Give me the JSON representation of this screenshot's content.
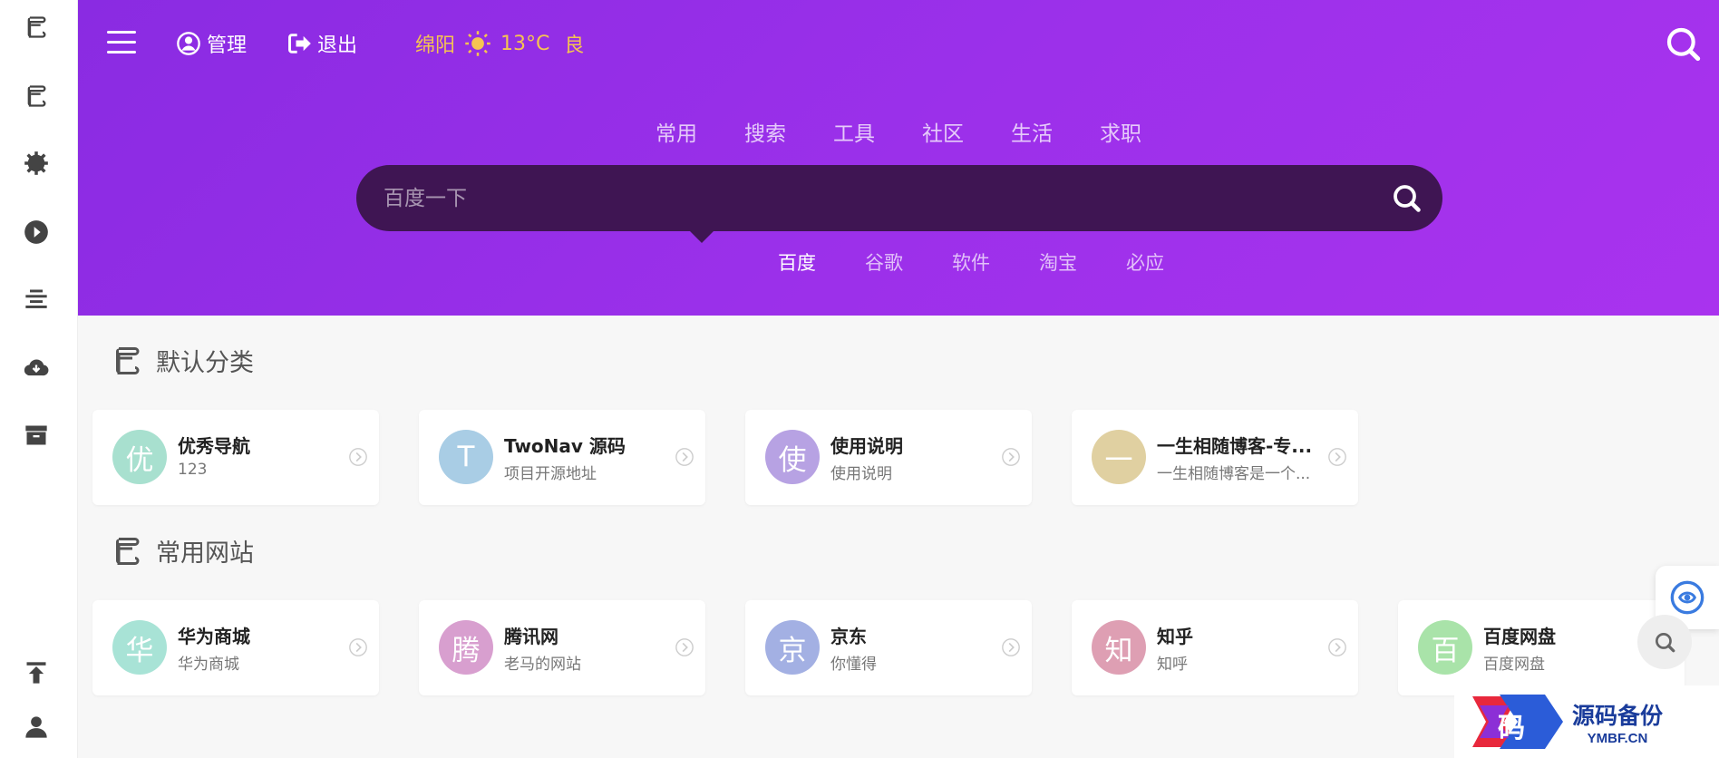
{
  "topbar": {
    "manage_label": "管理",
    "logout_label": "退出",
    "weather": {
      "city": "绵阳",
      "temp": "13°C",
      "quality": "良"
    }
  },
  "category_tabs": [
    "常用",
    "搜索",
    "工具",
    "社区",
    "生活",
    "求职"
  ],
  "search": {
    "placeholder": "百度一下"
  },
  "engine_tabs": [
    "百度",
    "谷歌",
    "软件",
    "淘宝",
    "必应"
  ],
  "sections": [
    {
      "title": "默认分类",
      "cards": [
        {
          "letter": "优",
          "name": "优秀导航",
          "desc": "123",
          "color": "#a8e0cf"
        },
        {
          "letter": "T",
          "name": "TwoNav 源码",
          "desc": "项目开源地址",
          "color": "#a9cde5"
        },
        {
          "letter": "使",
          "name": "使用说明",
          "desc": "使用说明",
          "color": "#b7a2e3"
        },
        {
          "letter": "一",
          "name": "一生相随博客-专...",
          "desc": "一生相随博客是一个...",
          "color": "#e0d0a1"
        }
      ]
    },
    {
      "title": "常用网站",
      "cards": [
        {
          "letter": "华",
          "name": "华为商城",
          "desc": "华为商城",
          "color": "#a8e3d6"
        },
        {
          "letter": "腾",
          "name": "腾讯网",
          "desc": "老马的网站",
          "color": "#d89fcf"
        },
        {
          "letter": "京",
          "name": "京东",
          "desc": "你懂得",
          "color": "#a3b0e3"
        },
        {
          "letter": "知",
          "name": "知乎",
          "desc": "知呼",
          "color": "#de9fb3"
        },
        {
          "letter": "百",
          "name": "百度网盘",
          "desc": "百度网盘",
          "color": "#a9e3a9"
        }
      ]
    }
  ],
  "watermark": {
    "cn": "源码备份",
    "en": "YMBF.CN",
    "logo_char": "码"
  },
  "colors": {
    "header_purple": "#9b30ea",
    "search_bg": "#3f1553",
    "weather": "#f5c451"
  }
}
